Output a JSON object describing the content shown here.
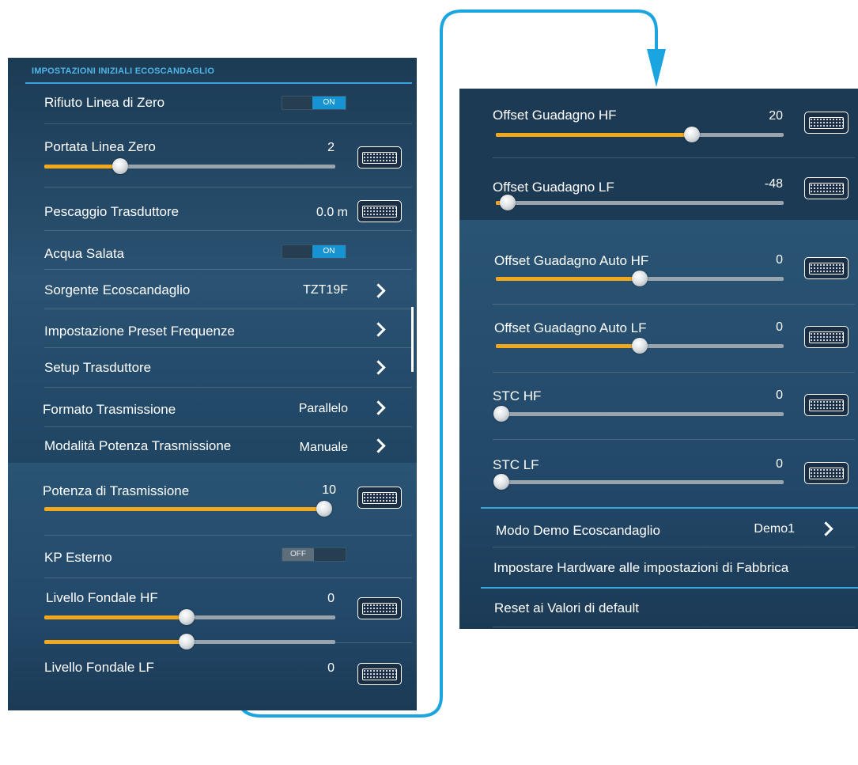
{
  "left_panel": {
    "header": "IMPOSTAZIONI INIZIALI ECOSCANDAGLIO",
    "rifiuto": {
      "label": "Rifiuto Linea di Zero",
      "toggle": "ON"
    },
    "portata": {
      "label": "Portata Linea Zero",
      "value": "2",
      "fill": 0.26
    },
    "pescaggio": {
      "label": "Pescaggio Trasduttore",
      "value": "0.0 m"
    },
    "acqua": {
      "label": "Acqua Salata",
      "toggle": "ON"
    },
    "sorgente": {
      "label": "Sorgente Ecoscandaglio",
      "value": "TZT19F"
    },
    "preset": {
      "label": "Impostazione Preset Frequenze"
    },
    "setup": {
      "label": "Setup Trasduttore"
    },
    "formato": {
      "label": "Formato Trasmissione",
      "value": "Parallelo"
    },
    "modalita": {
      "label": "Modalità Potenza Trasmissione",
      "value": "Manuale"
    },
    "potenza": {
      "label": "Potenza di Trasmissione",
      "value": "10",
      "fill": 1.0
    },
    "kp": {
      "label": "KP Esterno",
      "toggle": "OFF"
    },
    "fondale_hf": {
      "label": "Livello Fondale HF",
      "value": "0",
      "fill": 0.49
    },
    "fondale_lf": {
      "label": "Livello Fondale LF",
      "value": "0",
      "fill": 0.49
    }
  },
  "right_panel": {
    "guadagno_hf": {
      "label": "Offset Guadagno HF",
      "value": "20",
      "fill": 0.68
    },
    "guadagno_lf": {
      "label": "Offset Guadagno LF",
      "value": "-48",
      "fill": 0.04
    },
    "auto_hf": {
      "label": "Offset Guadagno Auto HF",
      "value": "0",
      "fill": 0.5
    },
    "auto_lf": {
      "label": "Offset Guadagno Auto LF",
      "value": "0",
      "fill": 0.5
    },
    "stc_hf": {
      "label": "STC HF",
      "value": "0",
      "fill": 0.0
    },
    "stc_lf": {
      "label": "STC LF",
      "value": "0",
      "fill": 0.0
    },
    "demo": {
      "label": "Modo Demo Ecoscandaglio",
      "value": "Demo1"
    },
    "hardware": {
      "label": "Impostare Hardware alle impostazioni di Fabbrica"
    },
    "reset": {
      "label": "Reset ai Valori di default"
    }
  },
  "colors": {
    "accent": "#3aa4dc",
    "slider_fill": "#f2a81d",
    "connector": "#1aa4e0",
    "toggle_on": "#1593d3"
  }
}
